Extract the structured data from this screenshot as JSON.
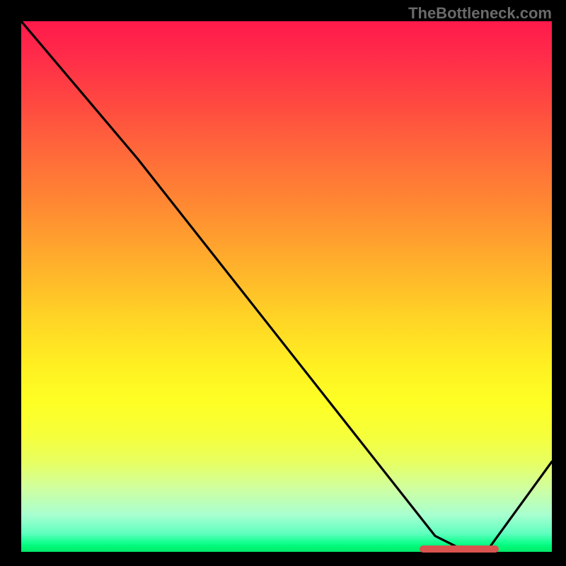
{
  "watermark": "TheBottleneck.com",
  "colors": {
    "background": "#000000",
    "watermark_text": "#6a6a6a",
    "curve": "#000000",
    "indicator": "#d9534f"
  },
  "chart_data": {
    "type": "line",
    "title": "",
    "xlabel": "",
    "ylabel": "",
    "xlim": [
      0,
      100
    ],
    "ylim": [
      0,
      100
    ],
    "grid": false,
    "series": [
      {
        "name": "curve",
        "x": [
          0,
          22,
          78,
          83,
          88,
          100
        ],
        "values": [
          100,
          74,
          3,
          0.5,
          0.5,
          17
        ]
      }
    ],
    "optimal_region": {
      "x_start": 75,
      "x_end": 90,
      "y": 0.5
    },
    "background_gradient": {
      "top": "#ff1a4b",
      "mid": "#ffd126",
      "bottom": "#00e86a",
      "direction": "vertical",
      "meaning": "bottleneck severity (red=high, green=optimal)"
    }
  }
}
